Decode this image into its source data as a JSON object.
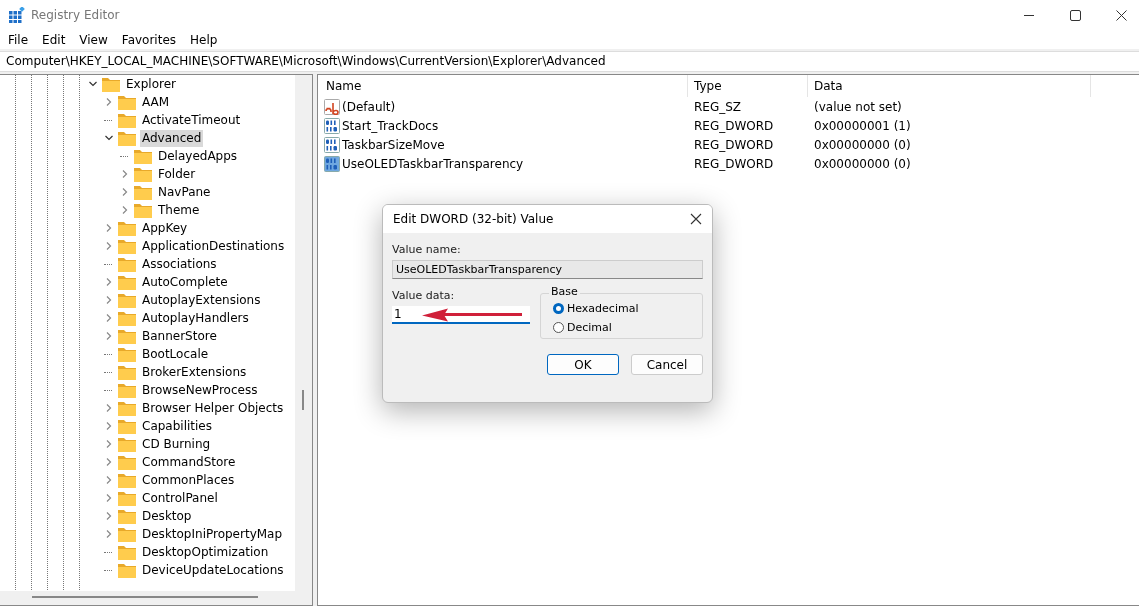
{
  "window": {
    "title": "Registry Editor"
  },
  "menu": [
    "File",
    "Edit",
    "View",
    "Favorites",
    "Help"
  ],
  "address": "Computer\\HKEY_LOCAL_MACHINE\\SOFTWARE\\Microsoft\\Windows\\CurrentVersion\\Explorer\\Advanced",
  "tree": [
    {
      "label": "Explorer",
      "expandable": true,
      "expanded": true,
      "selected": false,
      "children": [
        {
          "label": "AAM",
          "expandable": true,
          "expanded": false,
          "selected": false
        },
        {
          "label": "ActivateTimeout",
          "expandable": false,
          "selected": false
        },
        {
          "label": "Advanced",
          "expandable": true,
          "expanded": true,
          "selected": true,
          "children": [
            {
              "label": "DelayedApps",
              "expandable": false,
              "selected": false
            },
            {
              "label": "Folder",
              "expandable": true,
              "expanded": false,
              "selected": false
            },
            {
              "label": "NavPane",
              "expandable": true,
              "expanded": false,
              "selected": false
            },
            {
              "label": "Theme",
              "expandable": true,
              "expanded": false,
              "selected": false
            }
          ]
        },
        {
          "label": "AppKey",
          "expandable": true,
          "expanded": false,
          "selected": false
        },
        {
          "label": "ApplicationDestinations",
          "expandable": true,
          "expanded": false,
          "selected": false
        },
        {
          "label": "Associations",
          "expandable": false,
          "selected": false
        },
        {
          "label": "AutoComplete",
          "expandable": true,
          "expanded": false,
          "selected": false
        },
        {
          "label": "AutoplayExtensions",
          "expandable": true,
          "expanded": false,
          "selected": false
        },
        {
          "label": "AutoplayHandlers",
          "expandable": true,
          "expanded": false,
          "selected": false
        },
        {
          "label": "BannerStore",
          "expandable": true,
          "expanded": false,
          "selected": false
        },
        {
          "label": "BootLocale",
          "expandable": false,
          "selected": false
        },
        {
          "label": "BrokerExtensions",
          "expandable": false,
          "selected": false
        },
        {
          "label": "BrowseNewProcess",
          "expandable": false,
          "selected": false
        },
        {
          "label": "Browser Helper Objects",
          "expandable": true,
          "expanded": false,
          "selected": false
        },
        {
          "label": "Capabilities",
          "expandable": true,
          "expanded": false,
          "selected": false
        },
        {
          "label": "CD Burning",
          "expandable": true,
          "expanded": false,
          "selected": false
        },
        {
          "label": "CommandStore",
          "expandable": true,
          "expanded": false,
          "selected": false
        },
        {
          "label": "CommonPlaces",
          "expandable": true,
          "expanded": false,
          "selected": false
        },
        {
          "label": "ControlPanel",
          "expandable": true,
          "expanded": false,
          "selected": false
        },
        {
          "label": "Desktop",
          "expandable": true,
          "expanded": false,
          "selected": false
        },
        {
          "label": "DesktopIniPropertyMap",
          "expandable": true,
          "expanded": false,
          "selected": false
        },
        {
          "label": "DesktopOptimization",
          "expandable": false,
          "selected": false
        },
        {
          "label": "DeviceUpdateLocations",
          "expandable": false,
          "selected": false
        }
      ]
    }
  ],
  "table": {
    "columns": [
      "Name",
      "Type",
      "Data"
    ],
    "rows": [
      {
        "kind": "string",
        "name": "(Default)",
        "type": "REG_SZ",
        "data": "(value not set)",
        "selected": false
      },
      {
        "kind": "dword",
        "name": "Start_TrackDocs",
        "type": "REG_DWORD",
        "data": "0x00000001 (1)",
        "selected": false
      },
      {
        "kind": "dword",
        "name": "TaskbarSizeMove",
        "type": "REG_DWORD",
        "data": "0x00000000 (0)",
        "selected": false
      },
      {
        "kind": "dword",
        "name": "UseOLEDTaskbarTransparency",
        "type": "REG_DWORD",
        "data": "0x00000000 (0)",
        "selected": true
      }
    ]
  },
  "dialog": {
    "title": "Edit DWORD (32-bit) Value",
    "value_name_label": "Value name:",
    "value_name": "UseOLEDTaskbarTransparency",
    "value_data_label": "Value data:",
    "value_data": "1",
    "base_label": "Base",
    "base_options": [
      {
        "label": "Hexadecimal",
        "selected": true
      },
      {
        "label": "Decimal",
        "selected": false
      }
    ],
    "buttons": [
      {
        "label": "OK",
        "default": true
      },
      {
        "label": "Cancel",
        "default": false
      }
    ]
  }
}
